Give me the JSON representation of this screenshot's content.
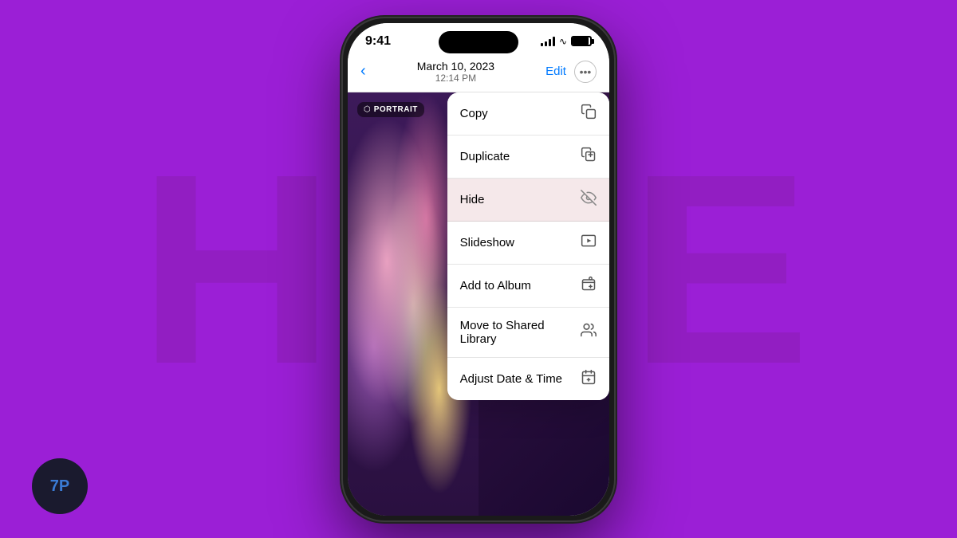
{
  "background": {
    "text": "HIDE",
    "color": "#9b1fd6"
  },
  "logo": {
    "text": "7P"
  },
  "phone": {
    "statusBar": {
      "time": "9:41"
    },
    "navBar": {
      "date": "March 10, 2023",
      "time": "12:14 PM",
      "editLabel": "Edit",
      "backIcon": "‹"
    },
    "portraitBadge": {
      "text": "PORTRAIT"
    },
    "contextMenu": {
      "items": [
        {
          "label": "Copy",
          "icon": "⧉",
          "active": false
        },
        {
          "label": "Duplicate",
          "icon": "⊞",
          "active": false
        },
        {
          "label": "Hide",
          "icon": "◎̶",
          "active": true
        },
        {
          "label": "Slideshow",
          "icon": "▶",
          "active": false
        },
        {
          "label": "Add to Album",
          "icon": "⊕",
          "active": false
        },
        {
          "label": "Move to Shared Library",
          "icon": "👥",
          "active": false
        },
        {
          "label": "Adjust Date & Time",
          "icon": "📅",
          "active": false
        }
      ]
    }
  }
}
